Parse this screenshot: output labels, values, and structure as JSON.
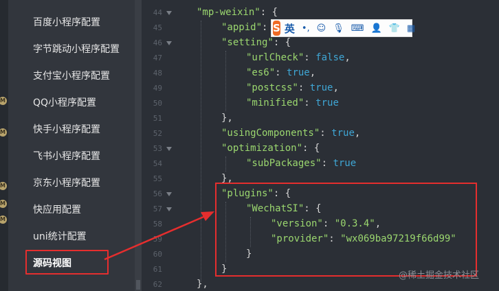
{
  "sidebar": {
    "items": [
      {
        "label": "百度小程序配置"
      },
      {
        "label": "字节跳动小程序配置"
      },
      {
        "label": "支付宝小程序配置"
      },
      {
        "label": "QQ小程序配置"
      },
      {
        "label": "快手小程序配置"
      },
      {
        "label": "飞书小程序配置"
      },
      {
        "label": "京东小程序配置"
      },
      {
        "label": "快应用配置"
      },
      {
        "label": "uni统计配置"
      },
      {
        "label": "源码视图"
      }
    ],
    "active_label": "源码视图"
  },
  "gutter": {
    "badge_text": "M"
  },
  "editor": {
    "lines": [
      {
        "num": "44"
      },
      {
        "num": "45"
      },
      {
        "num": "46"
      },
      {
        "num": "47"
      },
      {
        "num": "48"
      },
      {
        "num": "49"
      },
      {
        "num": "50"
      },
      {
        "num": "51"
      },
      {
        "num": "52"
      },
      {
        "num": "53"
      },
      {
        "num": "54"
      },
      {
        "num": "55"
      },
      {
        "num": "56"
      },
      {
        "num": "57"
      },
      {
        "num": "58"
      },
      {
        "num": "59"
      },
      {
        "num": "60"
      },
      {
        "num": "61"
      },
      {
        "num": "62"
      }
    ],
    "code": {
      "l44_key": "\"mp-weixin\"",
      "l44_rest": ": {",
      "l45_key": "\"appid\"",
      "l45_rest": ":",
      "l46_key": "\"setting\"",
      "l46_rest": ": {",
      "l47_key": "\"urlCheck\"",
      "l47_val": "false",
      "l48_key": "\"es6\"",
      "l48_val": "true",
      "l49_key": "\"postcss\"",
      "l49_val": "true",
      "l50_key": "\"minified\"",
      "l50_val": "true",
      "l51": "},",
      "l52_key": "\"usingComponents\"",
      "l52_val": "true",
      "l53_key": "\"optimization\"",
      "l53_rest": ": {",
      "l54_key": "\"subPackages\"",
      "l54_val": "true",
      "l55": "},",
      "l56_key": "\"plugins\"",
      "l56_rest": ": {",
      "l57_key": "\"WechatSI\"",
      "l57_rest": ": {",
      "l58_key": "\"version\"",
      "l58_val": "\"0.3.4\"",
      "l59_key": "\"provider\"",
      "l59_val": "\"wx069ba97219f66d99\"",
      "l60": "}",
      "l61": "}",
      "l62": "},",
      "colon": ": ",
      "comma": ","
    }
  },
  "ime": {
    "logo": "S",
    "lang": "英",
    "punct": "•,",
    "icons": [
      "smiley-icon",
      "mic-icon",
      "keyboard-icon",
      "user-icon",
      "shirt-icon",
      "grid-icon"
    ]
  },
  "watermark": "@稀土掘金技术社区",
  "colors": {
    "highlight": "#e62e2e",
    "string": "#9bd76f",
    "boolean": "#3fa7d6",
    "ime_logo": "#f06a25"
  }
}
